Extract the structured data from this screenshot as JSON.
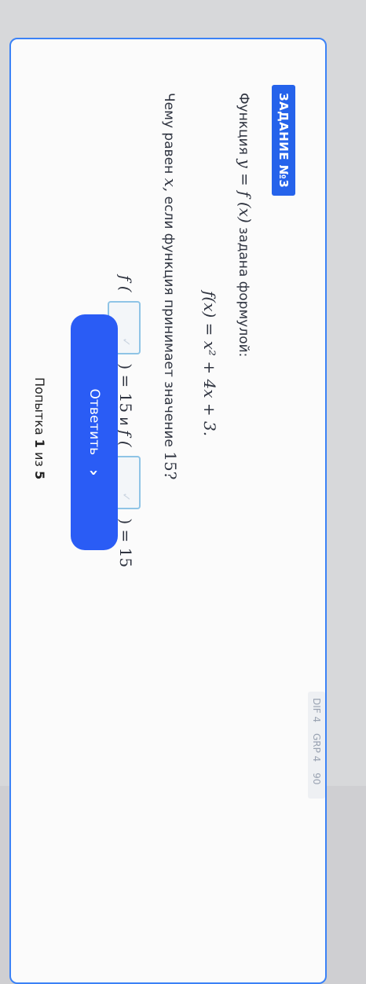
{
  "task": {
    "badge": "ЗАДАНИЕ №3",
    "meta": [
      "DIF 4",
      "GRP 4",
      "90"
    ]
  },
  "question": {
    "line1_pre": "Функция",
    "line1_math": "y = f (x)",
    "line1_post": "задана формулой:",
    "formula": "f(x) = x² + 4x + 3.",
    "line3_pre": "Чему равен",
    "line3_math": "x,",
    "line3_post": "если функция принимает значение",
    "line3_val": "15?",
    "eq1_pre": "f (",
    "eq1_post": ") = 15",
    "conj": "и",
    "eq2_pre": "f (",
    "eq2_post": ") = 15"
  },
  "inputs": {
    "answer1": "",
    "answer2": ""
  },
  "actions": {
    "submit_label": "Ответить",
    "attempt_prefix": "Попытка",
    "attempt_current": "1",
    "attempt_mid": "из",
    "attempt_total": "5"
  }
}
